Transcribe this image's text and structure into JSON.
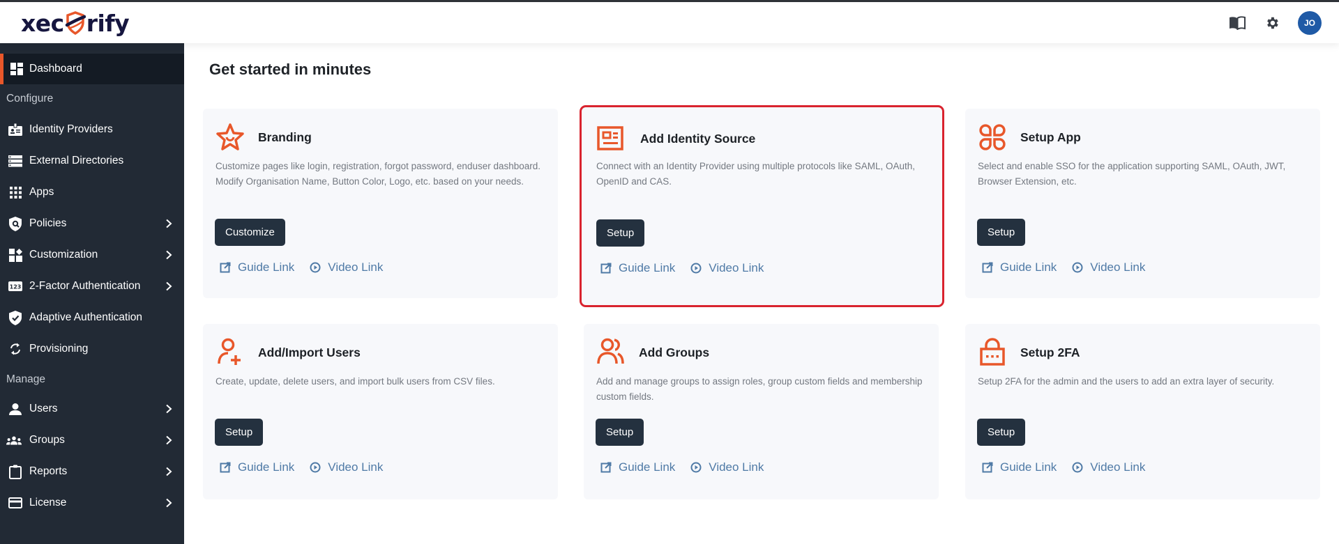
{
  "header": {
    "logo_left": "xec",
    "logo_right": "rify",
    "icons": [
      "book-icon",
      "gear-icon"
    ],
    "avatar_initials": "JO"
  },
  "sidebar": {
    "items": [
      {
        "label": "Dashboard",
        "icon": "dashboard-icon",
        "active": true,
        "chevron": false
      },
      {
        "label": "Identity Providers",
        "icon": "id-badge-icon",
        "chevron": false
      },
      {
        "label": "External Directories",
        "icon": "directory-list-icon",
        "chevron": false
      },
      {
        "label": "Apps",
        "icon": "apps-grid-icon",
        "chevron": false
      },
      {
        "label": "Policies",
        "icon": "shield-search-icon",
        "chevron": true
      },
      {
        "label": "Customization",
        "icon": "widgets-icon",
        "chevron": true
      },
      {
        "label": "2-Factor Authentication",
        "icon": "numeric-123-icon",
        "chevron": true
      },
      {
        "label": "Adaptive Authentication",
        "icon": "shield-check-icon",
        "chevron": false
      },
      {
        "label": "Provisioning",
        "icon": "sync-icon",
        "chevron": false
      },
      {
        "label": "Users",
        "icon": "user-icon",
        "chevron": true
      },
      {
        "label": "Groups",
        "icon": "groups-icon",
        "chevron": true
      },
      {
        "label": "Reports",
        "icon": "clipboard-icon",
        "chevron": true
      },
      {
        "label": "License",
        "icon": "credit-card-icon",
        "chevron": true
      }
    ],
    "sections": {
      "configure": "Configure",
      "manage": "Manage"
    }
  },
  "main": {
    "title": "Get started in minutes",
    "cards": [
      {
        "title": "Branding",
        "icon": "star-smile-icon",
        "description": "Customize pages like login, registration, forgot password, enduser dashboard. Modify Organisation Name, Button Color, Logo, etc. based on your needs.",
        "button": "Customize",
        "guide_link": "Guide Link",
        "video_link": "Video Link",
        "highlighted": false
      },
      {
        "title": "Add Identity Source",
        "icon": "id-card-icon",
        "description": "Connect with an Identity Provider using multiple protocols like SAML, OAuth, OpenID and CAS.",
        "button": "Setup",
        "guide_link": "Guide Link",
        "video_link": "Video Link",
        "highlighted": true
      },
      {
        "title": "Setup App",
        "icon": "apps-clover-icon",
        "description": "Select and enable SSO for the application supporting SAML, OAuth, JWT, Browser Extension, etc.",
        "button": "Setup",
        "guide_link": "Guide Link",
        "video_link": "Video Link",
        "highlighted": false
      },
      {
        "title": "Add/Import Users",
        "icon": "user-plus-icon",
        "description": "Create, update, delete users, and import bulk users from CSV files.",
        "button": "Setup",
        "guide_link": "Guide Link",
        "video_link": "Video Link",
        "highlighted": false
      },
      {
        "title": "Add Groups",
        "icon": "users-group-icon",
        "description": "Add and manage groups to assign roles, group custom fields and membership custom fields.",
        "button": "Setup",
        "guide_link": "Guide Link",
        "video_link": "Video Link",
        "highlighted": false
      },
      {
        "title": "Setup 2FA",
        "icon": "lock-dots-icon",
        "description": "Setup 2FA for the admin and the users to add an extra layer of security.",
        "button": "Setup",
        "guide_link": "Guide Link",
        "video_link": "Video Link",
        "highlighted": false
      }
    ]
  },
  "colors": {
    "accent": "#e8572a",
    "sidebar_bg": "#222a35",
    "sidebar_active_bg": "#141b24",
    "button_bg": "#24313f",
    "link": "#4f7aa6",
    "highlight_border": "#d9232e",
    "avatar_bg": "#1f5aa6"
  }
}
